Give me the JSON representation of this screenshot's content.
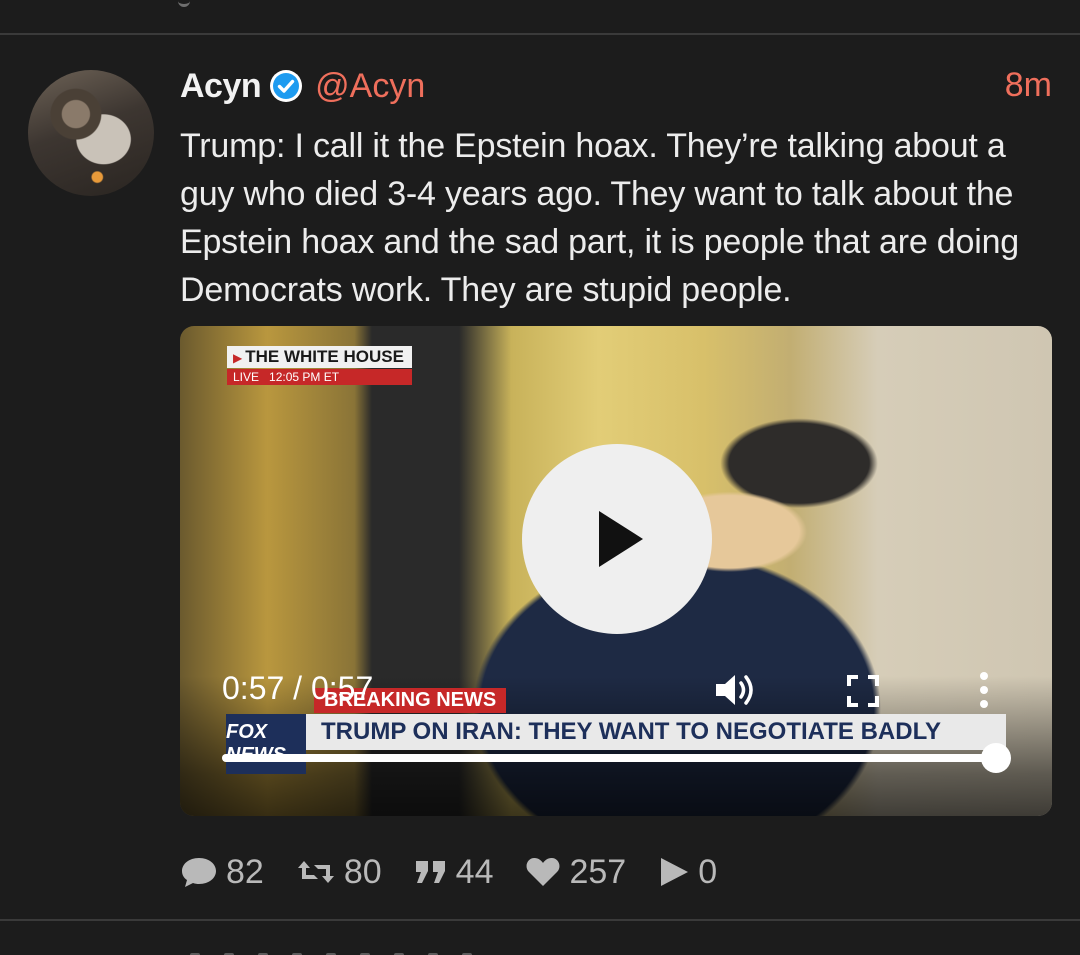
{
  "tweet": {
    "display_name": "Acyn",
    "handle": "@Acyn",
    "time": "8m",
    "text": "Trump: I call it the Epstein hoax. They’re talking about a guy who died 3-4 years ago. They want to talk about the Epstein hoax and the sad part, it is people that are doing Democrats work. They are stupid people.",
    "verified_icon": "verified-badge-icon"
  },
  "video": {
    "overlay_title": "THE WHITE HOUSE",
    "overlay_live": "LIVE",
    "overlay_time": "12:05 PM ET",
    "breaking": "BREAKING NEWS",
    "chyron": "TRUMP ON IRAN: THEY WANT TO NEGOTIATE BADLY",
    "logo": "FOX NEWS",
    "current_time": "0:57",
    "duration": "0:57",
    "time_readout": "0:57 / 0:57",
    "progress_fraction": 1.0,
    "icons": [
      "play-icon",
      "volume-icon",
      "fullscreen-icon",
      "more-vertical-icon"
    ]
  },
  "actions": {
    "replies": "82",
    "retweets": "80",
    "quotes": "44",
    "likes": "257",
    "views": "0"
  },
  "colors": {
    "background": "#1c1c1c",
    "accent": "#ef6f5c",
    "verified": "#1d9bf0",
    "text": "#ececec",
    "muted": "#b9b9b9"
  }
}
